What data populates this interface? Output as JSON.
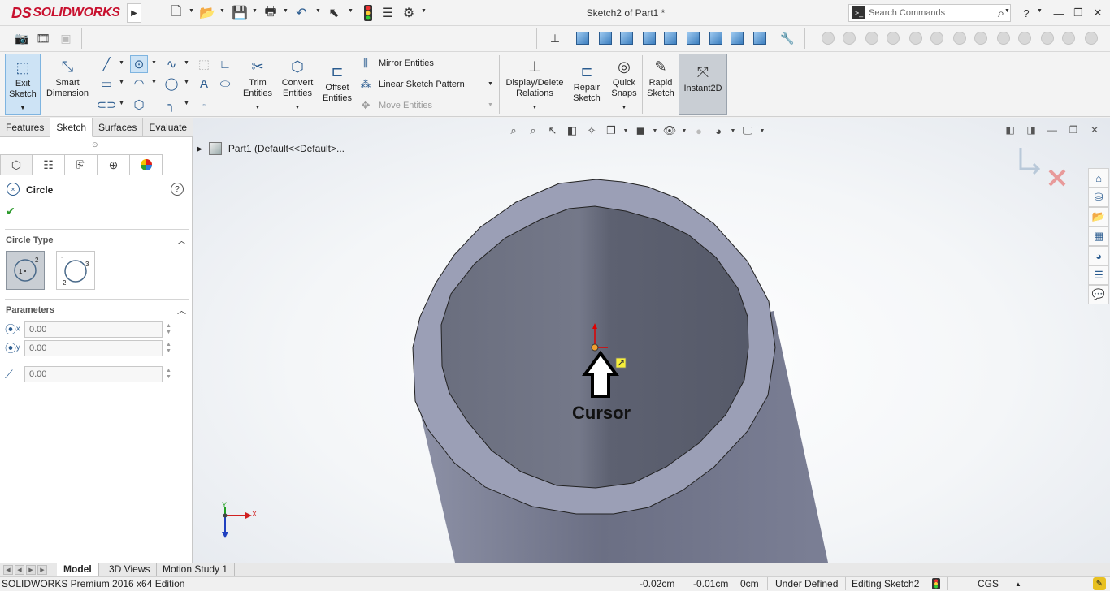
{
  "app": {
    "brand": "SOLIDWORKS",
    "brand_prefix": "DS",
    "document_title": "Sketch2 of Part1 *",
    "search_placeholder": "Search Commands"
  },
  "window_controls": {
    "help": "?",
    "minimize": "—",
    "restore": "❐",
    "close": "✕"
  },
  "command_manager": {
    "exit_sketch": "Exit\nSketch",
    "smart_dimension": "Smart\nDimension",
    "trim_entities": "Trim\nEntities",
    "convert_entities": "Convert\nEntities",
    "offset_entities": "Offset\nEntities",
    "mirror_entities": "Mirror Entities",
    "linear_sketch_pattern": "Linear Sketch Pattern",
    "move_entities": "Move Entities",
    "display_delete_relations": "Display/Delete\nRelations",
    "repair_sketch": "Repair\nSketch",
    "quick_snaps": "Quick\nSnaps",
    "rapid_sketch": "Rapid\nSketch",
    "instant2d": "Instant2D"
  },
  "tabs": [
    {
      "label": "Features"
    },
    {
      "label": "Sketch"
    },
    {
      "label": "Surfaces"
    },
    {
      "label": "Evaluate"
    }
  ],
  "property_manager": {
    "title": "Circle",
    "help": "?",
    "ok": "✔",
    "circle_type_header": "Circle Type",
    "parameters_header": "Parameters",
    "center_x": "0.00",
    "center_y": "0.00",
    "radius": "0.00"
  },
  "feature_tree": {
    "root": "Part1  (Default<<Default>..."
  },
  "graphics": {
    "cursor_label": "Cursor",
    "triad": {
      "x": "X",
      "y": "Y"
    }
  },
  "bottom_tabs": [
    {
      "label": "Model"
    },
    {
      "label": "3D Views"
    },
    {
      "label": "Motion Study 1"
    }
  ],
  "status_bar": {
    "edition": "SOLIDWORKS Premium 2016 x64 Edition",
    "x_coord": "-0.02cm",
    "y_coord": "-0.01cm",
    "z_coord": "0cm",
    "definition": "Under Defined",
    "editing": "Editing Sketch2",
    "units": "CGS"
  },
  "colors": {
    "brand_red": "#c8102e",
    "accent_blue": "#2a5b8f",
    "pipe_outer": "#9a9eb6",
    "pipe_inner": "#5f6373",
    "origin_red": "#e00000"
  }
}
